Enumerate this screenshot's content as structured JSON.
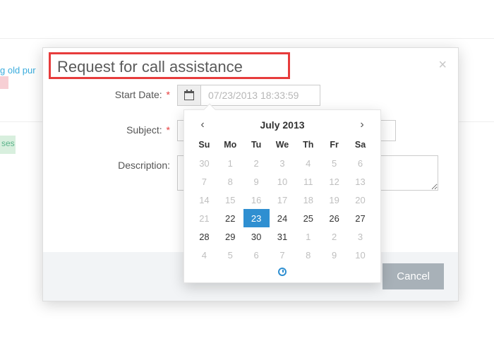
{
  "background": {
    "link_text": "g old pur",
    "side_label": "ses"
  },
  "modal": {
    "title": "Request for call assistance",
    "labels": {
      "start_date": "Start Date:",
      "subject": "Subject:",
      "description": "Description:",
      "required_marker": "*"
    },
    "start_date": {
      "placeholder": "07/23/2013 18:33:59",
      "value": ""
    },
    "subject_value": "",
    "description_value": "",
    "cancel_label": "Cancel"
  },
  "datepicker": {
    "title": "July 2013",
    "dow": [
      "Su",
      "Mo",
      "Tu",
      "We",
      "Th",
      "Fr",
      "Sa"
    ],
    "weeks": [
      [
        {
          "d": "30",
          "s": "m"
        },
        {
          "d": "1",
          "s": "m"
        },
        {
          "d": "2",
          "s": "m"
        },
        {
          "d": "3",
          "s": "m"
        },
        {
          "d": "4",
          "s": "m"
        },
        {
          "d": "5",
          "s": "m"
        },
        {
          "d": "6",
          "s": "m"
        }
      ],
      [
        {
          "d": "7",
          "s": "m"
        },
        {
          "d": "8",
          "s": "m"
        },
        {
          "d": "9",
          "s": "m"
        },
        {
          "d": "10",
          "s": "m"
        },
        {
          "d": "11",
          "s": "m"
        },
        {
          "d": "12",
          "s": "m"
        },
        {
          "d": "13",
          "s": "m"
        }
      ],
      [
        {
          "d": "14",
          "s": "m"
        },
        {
          "d": "15",
          "s": "m"
        },
        {
          "d": "16",
          "s": "m"
        },
        {
          "d": "17",
          "s": "m"
        },
        {
          "d": "18",
          "s": "m"
        },
        {
          "d": "19",
          "s": "m"
        },
        {
          "d": "20",
          "s": "m"
        }
      ],
      [
        {
          "d": "21",
          "s": "m"
        },
        {
          "d": "22",
          "s": "n"
        },
        {
          "d": "23",
          "s": "sel"
        },
        {
          "d": "24",
          "s": "n"
        },
        {
          "d": "25",
          "s": "n"
        },
        {
          "d": "26",
          "s": "n"
        },
        {
          "d": "27",
          "s": "n"
        }
      ],
      [
        {
          "d": "28",
          "s": "n"
        },
        {
          "d": "29",
          "s": "n"
        },
        {
          "d": "30",
          "s": "n"
        },
        {
          "d": "31",
          "s": "n"
        },
        {
          "d": "1",
          "s": "m"
        },
        {
          "d": "2",
          "s": "m"
        },
        {
          "d": "3",
          "s": "m"
        }
      ],
      [
        {
          "d": "4",
          "s": "m"
        },
        {
          "d": "5",
          "s": "m"
        },
        {
          "d": "6",
          "s": "m"
        },
        {
          "d": "7",
          "s": "m"
        },
        {
          "d": "8",
          "s": "m"
        },
        {
          "d": "9",
          "s": "m"
        },
        {
          "d": "10",
          "s": "m"
        }
      ]
    ]
  }
}
